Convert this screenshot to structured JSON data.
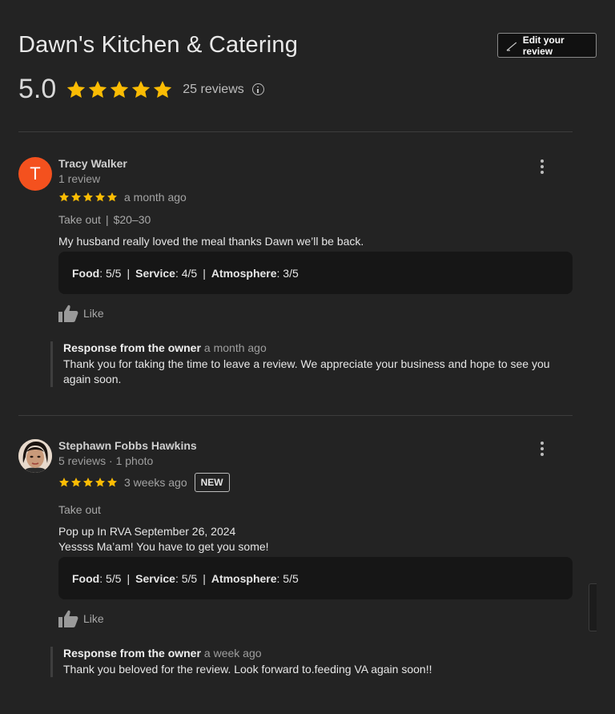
{
  "header": {
    "title": "Dawn's Kitchen & Catering",
    "edit_label": "Edit your review",
    "rating": "5.0",
    "review_count": "25 reviews"
  },
  "colors": {
    "star": "#fbbc04",
    "avatar_t": "#f4511e"
  },
  "reviews": [
    {
      "initial": "T",
      "name": "Tracy Walker",
      "sub": "1 review",
      "ago": "a month ago",
      "meta_service": "Take out",
      "meta_price": "$20–30",
      "text_lines": [
        "My husband really loved the meal thanks Dawn we’ll be back."
      ],
      "ratings": {
        "food_label": "Food",
        "food": ": 5/5",
        "service_label": "Service",
        "service": ": 4/5",
        "atmosphere_label": "Atmosphere",
        "atmosphere": ": 3/5"
      },
      "like": "Like",
      "owner": {
        "label": "Response from the owner",
        "ago": "a month ago",
        "text": "Thank you for taking the time to leave a review. We appreciate your business and hope to see you again soon."
      }
    },
    {
      "name": "Stephawn Fobbs Hawkins",
      "sub": "5 reviews · 1 photo",
      "ago": "3 weeks ago",
      "badge": "NEW",
      "meta_service": "Take out",
      "text_lines": [
        "Pop up In RVA September 26, 2024",
        "Yessss Ma’am! You have to get you some!"
      ],
      "ratings": {
        "food_label": "Food",
        "food": ": 5/5",
        "service_label": "Service",
        "service": ": 5/5",
        "atmosphere_label": "Atmosphere",
        "atmosphere": ": 5/5"
      },
      "like": "Like",
      "owner": {
        "label": "Response from the owner",
        "ago": "a week ago",
        "text": "Thank you beloved for the review. Look forward to.feeding VA again soon!!"
      }
    }
  ]
}
